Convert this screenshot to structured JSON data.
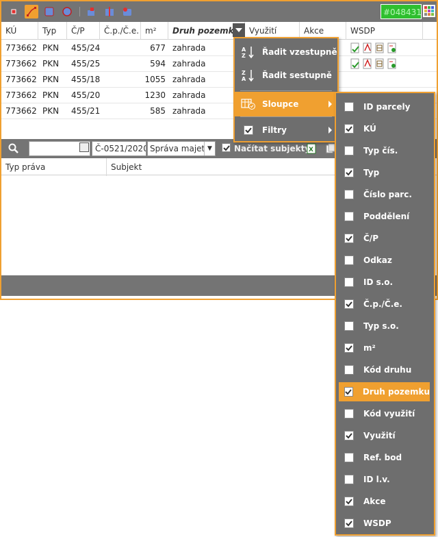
{
  "toolbar": {
    "buttons": [
      "point-tool-icon",
      "line-tool-icon",
      "polygon-tool-icon",
      "circle-tool-icon",
      "cut-tool-icon",
      "split-tool-icon",
      "merge-tool-icon"
    ],
    "color_value": "#048431",
    "colors": {
      "accent": "#f0a030",
      "toolbar": "#747474",
      "menu": "#6e6e6e",
      "color_box": "#2fbf2f"
    }
  },
  "grid": {
    "columns": [
      "KÚ",
      "Typ",
      "Č/P",
      "Č.p./Č.e.",
      "m²",
      "Druh pozemku",
      "Využití",
      "Akce",
      "WSDP"
    ],
    "rows": [
      [
        "773662",
        "PKN",
        "455/24",
        "",
        "677",
        "zahrada"
      ],
      [
        "773662",
        "PKN",
        "455/25",
        "",
        "594",
        "zahrada"
      ],
      [
        "773662",
        "PKN",
        "455/18",
        "",
        "1055",
        "zahrada"
      ],
      [
        "773662",
        "PKN",
        "455/20",
        "",
        "1230",
        "zahrada"
      ],
      [
        "773662",
        "PKN",
        "455/21",
        "",
        "585",
        "zahrada"
      ]
    ]
  },
  "subtoolbar": {
    "date_value": "",
    "plan_value": "Č-0521/2020",
    "select_value": "Správa majetk",
    "load_subjects_label": "Načítat subjekty",
    "load_subjects_checked": true
  },
  "subgrid": {
    "columns": [
      "Typ práva",
      "Subjekt"
    ]
  },
  "menu": {
    "sort_asc": "Řadit vzestupně",
    "sort_desc": "Řadit sestupně",
    "columns": "Sloupce",
    "filters": "Filtry"
  },
  "column_options": [
    {
      "label": "ID parcely",
      "checked": false
    },
    {
      "label": "KÚ",
      "checked": true
    },
    {
      "label": "Typ čís.",
      "checked": false
    },
    {
      "label": "Typ",
      "checked": true
    },
    {
      "label": "Číslo parc.",
      "checked": false
    },
    {
      "label": "Poddělení",
      "checked": false
    },
    {
      "label": "Č/P",
      "checked": true
    },
    {
      "label": "Odkaz",
      "checked": false
    },
    {
      "label": "ID s.o.",
      "checked": false
    },
    {
      "label": "Č.p./Č.e.",
      "checked": true
    },
    {
      "label": "Typ s.o.",
      "checked": false
    },
    {
      "label": "m²",
      "checked": true
    },
    {
      "label": "Kód druhu",
      "checked": false
    },
    {
      "label": "Druh pozemku",
      "checked": true,
      "active": true
    },
    {
      "label": "Kód využití",
      "checked": false
    },
    {
      "label": "Využití",
      "checked": true
    },
    {
      "label": "Ref. bod",
      "checked": false
    },
    {
      "label": "ID l.v.",
      "checked": false
    },
    {
      "label": "Akce",
      "checked": true
    },
    {
      "label": "WSDP",
      "checked": true
    }
  ]
}
